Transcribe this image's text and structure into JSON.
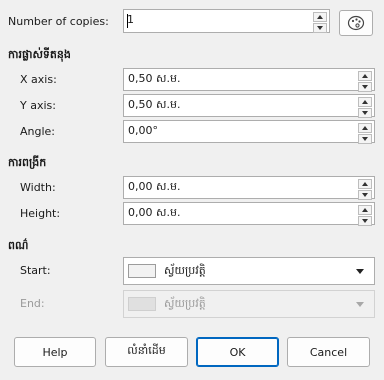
{
  "copies": {
    "label": "Number of copies:",
    "value": "1"
  },
  "placement": {
    "header": "ការផ្លាស់ទីតនុង",
    "x_label": "X axis:",
    "x_value": "0,50 ស.ម.",
    "y_label": "Y axis:",
    "y_value": "0,50 ស.ម.",
    "angle_label": "Angle:",
    "angle_value": "0,00°"
  },
  "enlargement": {
    "header": "ការពង្រីក",
    "width_label": "Width:",
    "width_value": "0,00 ស.ម.",
    "height_label": "Height:",
    "height_value": "0,00 ស.ម."
  },
  "colors": {
    "header": "ពណ៌",
    "start_label": "Start:",
    "start_value": "ស្វ័យប្រវត្តិ",
    "end_label": "End:",
    "end_value": "ស្វ័យប្រវត្តិ"
  },
  "buttons": {
    "help": "Help",
    "reset": "លំនាំដើម",
    "ok": "OK",
    "cancel": "Cancel"
  },
  "accent_color": "#0067c0"
}
